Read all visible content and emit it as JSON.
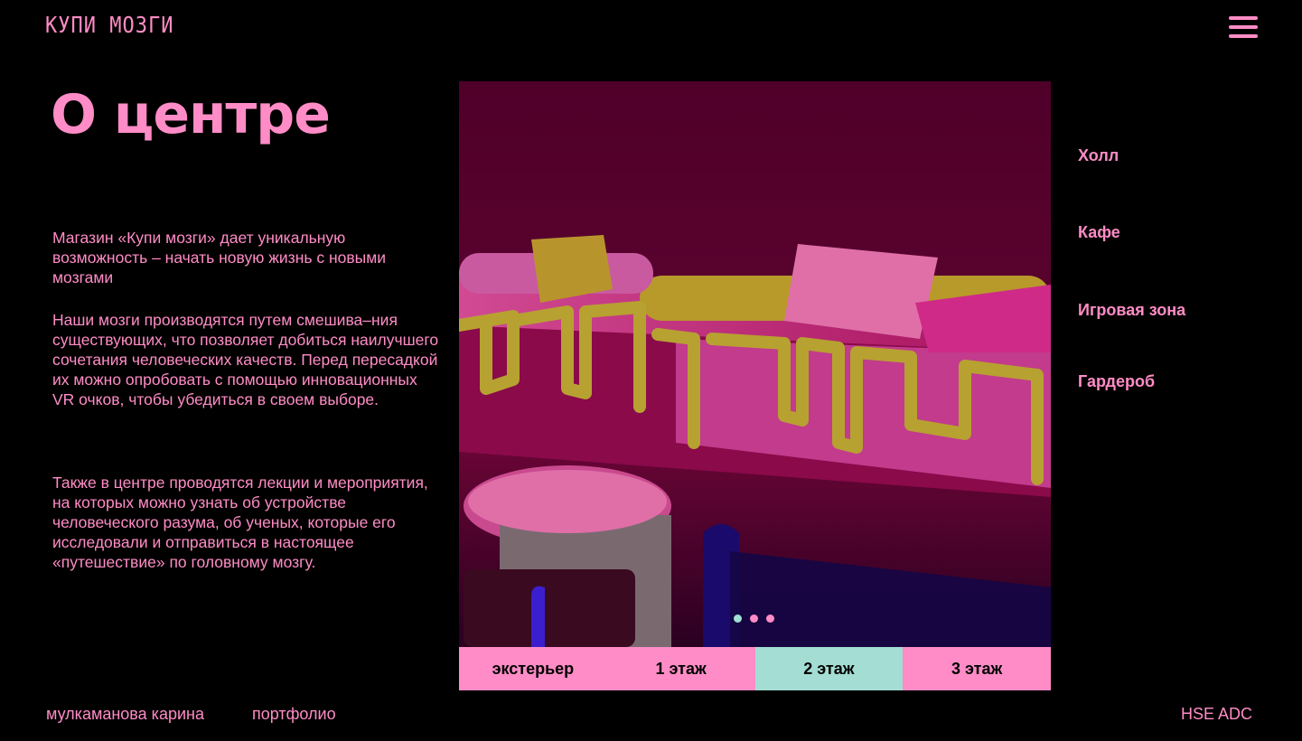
{
  "header": {
    "logo": "КУПИ МОЗГИ",
    "menu_icon": "hamburger-menu-icon"
  },
  "main": {
    "title": "О центре",
    "paragraphs": [
      "Магазин «Купи мозги» дает уникальную возможность – начать новую жизнь с новыми мозгами",
      "Наши мозги производятся путем смешива–ния существующих, что позволяет добиться наилучшего сочетания человеческих качеств. Перед пересадкой их можно опробовать с помощью инновационных VR очков, чтобы убедиться в своем выборе.",
      "Также в центре проводятся лекции и мероприятия, на которых можно узнать об устройстве человеческого разума, об ученых, которые его исследовали и отправиться в настоящее «путешествие» по головному мозгу."
    ]
  },
  "gallery": {
    "slide_count": 3,
    "active_slide": 1,
    "colors": {
      "active_dot": "#9fe0d4",
      "dot": "#ff8cc6"
    }
  },
  "floor_tabs": [
    {
      "label": "экстерьер",
      "active": false
    },
    {
      "label": "1 этаж",
      "active": false
    },
    {
      "label": "2 этаж",
      "active": true
    },
    {
      "label": "3 этаж",
      "active": false
    }
  ],
  "zones": [
    {
      "label": "Холл"
    },
    {
      "label": "Кафе"
    },
    {
      "label": "Игровая зона"
    },
    {
      "label": "Гардероб"
    }
  ],
  "footer": {
    "author": "мулкаманова карина",
    "portfolio": "портфолио",
    "school": "HSE ADC"
  },
  "colors": {
    "background": "#000000",
    "accent_pink": "#ff8cc6",
    "accent_mint": "#a3ddd3"
  }
}
